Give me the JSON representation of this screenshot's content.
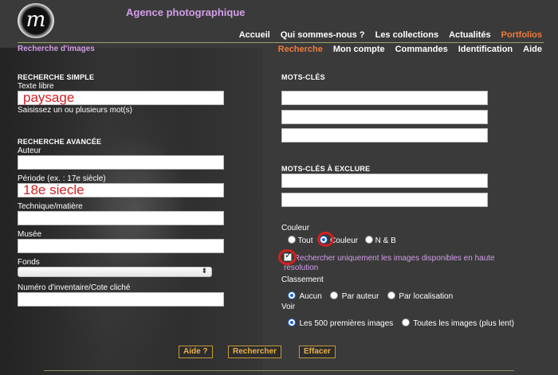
{
  "header": {
    "logo_letter": "m",
    "agency_name": "Agence photographique",
    "subtitle": "Recherche d'images"
  },
  "topnav": [
    "Accueil",
    "Qui sommes-nous ?",
    "Les collections",
    "Actualités",
    "Portfolios"
  ],
  "subnav": [
    "Recherche",
    "Mon compte",
    "Commandes",
    "Identification",
    "Aide"
  ],
  "simple": {
    "title": "RECHERCHE SIMPLE",
    "label": "Texte libre",
    "value": "paysage",
    "hint": "Saisissez un ou plusieurs mot(s)"
  },
  "advanced": {
    "title": "RECHERCHE AVANCÉE",
    "auteur": "Auteur",
    "periode": "Période (ex. : 17e siècle)",
    "periode_value": "18e siecle",
    "technique": "Technique/matière",
    "musee": "Musée",
    "fonds": "Fonds",
    "inventaire": "Numéro d'inventaire/Cote cliché"
  },
  "keywords": {
    "title": "MOTS-CLÉS",
    "exclude_title": "MOTS-CLÉS À EXCLURE"
  },
  "couleur": {
    "label": "Couleur",
    "options": [
      "Tout",
      "Couleur",
      "N & B"
    ]
  },
  "hires": {
    "label": "Rechercher uniquement les images disponibles en haute",
    "label2": "résolution"
  },
  "classement": {
    "label": "Classement",
    "options": [
      "Aucun",
      "Par auteur",
      "Par localisation"
    ]
  },
  "voir": {
    "label": "Voir",
    "options": [
      "Les 500 premières images",
      "Toutes les images (plus lent)"
    ]
  },
  "buttons": {
    "aide": "Aide ?",
    "rechercher": "Rechercher",
    "effacer": "Effacer"
  },
  "colors": {
    "accent_purple": "#d39ee9",
    "accent_orange": "#f07a3c",
    "annotation_red": "#d42020",
    "button_gold": "#e8b14a"
  }
}
